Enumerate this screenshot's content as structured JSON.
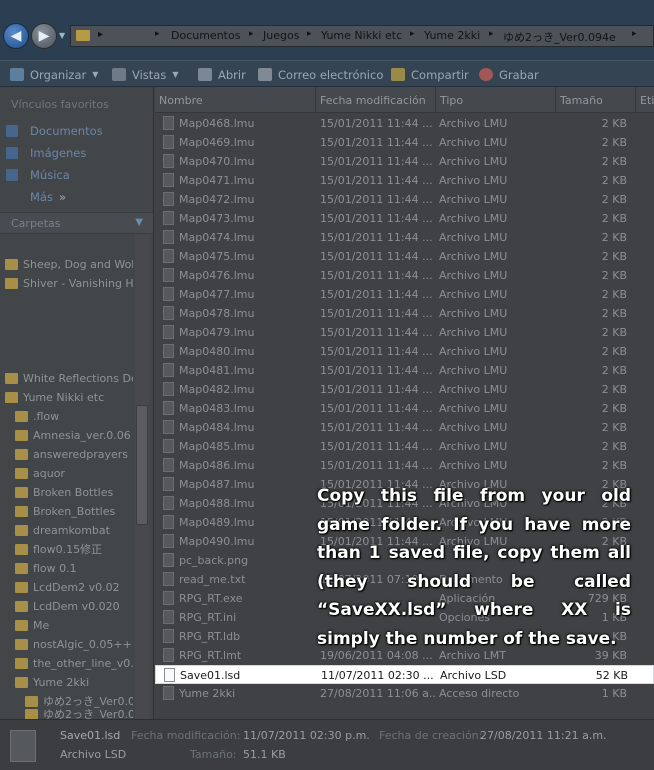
{
  "address_bar": {
    "breadcrumbs": [
      "Documentos",
      "Juegos",
      "Yume Nikki etc",
      "Yume 2kki",
      "ゆめ2っき_Ver0.094e"
    ]
  },
  "toolbar": {
    "organize": "Organizar",
    "views": "Vistas",
    "open": "Abrir",
    "email": "Correo electrónico",
    "share": "Compartir",
    "burn": "Grabar"
  },
  "nav": {
    "favorites_header": "Vínculos favoritos",
    "favorites": [
      "Documentos",
      "Imágenes",
      "Música"
    ],
    "more": "Más",
    "folders_header": "Carpetas",
    "tree_top": [
      "Sheep, Dog and Wolf",
      "Shiver - Vanishing Hi"
    ],
    "tree_main": [
      "White Reflections De",
      "Yume Nikki etc",
      ".flow",
      "Amnesia_ver.0.06",
      "answeredprayers",
      "aquor",
      "Broken Bottles",
      "Broken_Bottles",
      "dreamkombat",
      "flow0.15修正",
      "flow 0.1",
      "LcdDem2 v0.02",
      "LcdDem v0.020",
      "Me",
      "nostAlgic_0.05++",
      "the_other_line_v0.0",
      "Yume 2kki",
      "ゆめ2っき_Ver0.0",
      "ゆめ2っき_Ver0.0"
    ]
  },
  "columns": {
    "name": "Nombre",
    "date": "Fecha modificación",
    "type": "Tipo",
    "size": "Tamaño",
    "tags": "Eti"
  },
  "files": [
    {
      "name": "Map0468.lmu",
      "date": "15/01/2011 11:44 ...",
      "type": "Archivo LMU",
      "size": "2 KB"
    },
    {
      "name": "Map0469.lmu",
      "date": "15/01/2011 11:44 ...",
      "type": "Archivo LMU",
      "size": "2 KB"
    },
    {
      "name": "Map0470.lmu",
      "date": "15/01/2011 11:44 ...",
      "type": "Archivo LMU",
      "size": "2 KB"
    },
    {
      "name": "Map0471.lmu",
      "date": "15/01/2011 11:44 ...",
      "type": "Archivo LMU",
      "size": "2 KB"
    },
    {
      "name": "Map0472.lmu",
      "date": "15/01/2011 11:44 ...",
      "type": "Archivo LMU",
      "size": "2 KB"
    },
    {
      "name": "Map0473.lmu",
      "date": "15/01/2011 11:44 ...",
      "type": "Archivo LMU",
      "size": "2 KB"
    },
    {
      "name": "Map0474.lmu",
      "date": "15/01/2011 11:44 ...",
      "type": "Archivo LMU",
      "size": "2 KB"
    },
    {
      "name": "Map0475.lmu",
      "date": "15/01/2011 11:44 ...",
      "type": "Archivo LMU",
      "size": "2 KB"
    },
    {
      "name": "Map0476.lmu",
      "date": "15/01/2011 11:44 ...",
      "type": "Archivo LMU",
      "size": "2 KB"
    },
    {
      "name": "Map0477.lmu",
      "date": "15/01/2011 11:44 ...",
      "type": "Archivo LMU",
      "size": "2 KB"
    },
    {
      "name": "Map0478.lmu",
      "date": "15/01/2011 11:44 ...",
      "type": "Archivo LMU",
      "size": "2 KB"
    },
    {
      "name": "Map0479.lmu",
      "date": "15/01/2011 11:44 ...",
      "type": "Archivo LMU",
      "size": "2 KB"
    },
    {
      "name": "Map0480.lmu",
      "date": "15/01/2011 11:44 ...",
      "type": "Archivo LMU",
      "size": "2 KB"
    },
    {
      "name": "Map0481.lmu",
      "date": "15/01/2011 11:44 ...",
      "type": "Archivo LMU",
      "size": "2 KB"
    },
    {
      "name": "Map0482.lmu",
      "date": "15/01/2011 11:44 ...",
      "type": "Archivo LMU",
      "size": "2 KB"
    },
    {
      "name": "Map0483.lmu",
      "date": "15/01/2011 11:44 ...",
      "type": "Archivo LMU",
      "size": "2 KB"
    },
    {
      "name": "Map0484.lmu",
      "date": "15/01/2011 11:44 ...",
      "type": "Archivo LMU",
      "size": "2 KB"
    },
    {
      "name": "Map0485.lmu",
      "date": "15/01/2011 11:44 ...",
      "type": "Archivo LMU",
      "size": "2 KB"
    },
    {
      "name": "Map0486.lmu",
      "date": "15/01/2011 11:44 ...",
      "type": "Archivo LMU",
      "size": "2 KB"
    },
    {
      "name": "Map0487.lmu",
      "date": "15/01/2011 11:44 ...",
      "type": "Archivo LMU",
      "size": "2 KB"
    },
    {
      "name": "Map0488.lmu",
      "date": "15/01/2011 11:44 ...",
      "type": "Archivo LMU",
      "size": "2 KB"
    },
    {
      "name": "Map0489.lmu",
      "date": "15/01/2011 11:44 ...",
      "type": "Archivo LMU",
      "size": "2 KB"
    },
    {
      "name": "Map0490.lmu",
      "date": "15/01/2011 11:44 ...",
      "type": "Archivo LMU",
      "size": "2 KB"
    },
    {
      "name": "pc_back.png",
      "date": "",
      "type": "",
      "size": ""
    },
    {
      "name": "read_me.txt",
      "date": "11/07/2011 07:19",
      "type": "Documento",
      "size": ""
    },
    {
      "name": "RPG_RT.exe",
      "date": "",
      "type": "Aplicación",
      "size": "729 KB"
    },
    {
      "name": "RPG_RT.ini",
      "date": "",
      "type": "Opciones",
      "size": "1 KB"
    },
    {
      "name": "RPG_RT.ldb",
      "date": "",
      "type": "",
      "size": "KB"
    },
    {
      "name": "RPG_RT.lmt",
      "date": "19/06/2011 04:08 ...",
      "type": "Archivo LMT",
      "size": "39 KB"
    },
    {
      "name": "Save01.lsd",
      "date": "11/07/2011 02:30 ...",
      "type": "Archivo LSD",
      "size": "52 KB",
      "selected": true
    },
    {
      "name": "Yume 2kki",
      "date": "27/08/2011 11:06 a...",
      "type": "Acceso directo",
      "size": "1 KB"
    }
  ],
  "annotation": "Copy this file from your old game folder. If you have more than 1 saved file, copy them all (they should be called “SaveXX.lsd” where XX is simply the number of the save.",
  "details": {
    "name": "Save01.lsd",
    "type": "Archivo LSD",
    "modified_label": "Fecha modificación:",
    "modified_value": "11/07/2011 02:30 p.m.",
    "size_label": "Tamaño:",
    "size_value": "51.1 KB",
    "created_label": "Fecha de creación:",
    "created_value": "27/08/2011 11:21 a.m."
  }
}
